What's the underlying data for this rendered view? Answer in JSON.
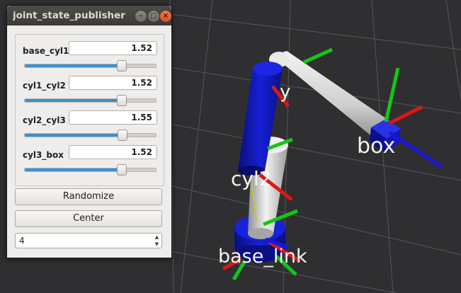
{
  "window": {
    "title": "joint_state_publisher",
    "minimize_glyph": "–",
    "maximize_glyph": "□",
    "close_glyph": "×"
  },
  "joints": [
    {
      "name": "base_cyl1",
      "value": "1.52",
      "slider_fraction": 0.735
    },
    {
      "name": "cyl1_cyl2",
      "value": "1.52",
      "slider_fraction": 0.735
    },
    {
      "name": "cyl2_cyl3",
      "value": "1.55",
      "slider_fraction": 0.74
    },
    {
      "name": "cyl3_box",
      "value": "1.52",
      "slider_fraction": 0.735
    }
  ],
  "buttons": {
    "randomize": "Randomize",
    "center": "Center"
  },
  "spinbox": {
    "value": "4",
    "up_glyph": "▲",
    "down_glyph": "▼"
  },
  "scene": {
    "labels": {
      "box": "box",
      "cyl2": "cyl2",
      "cyl1_partial": "y",
      "base_link": "base_link"
    },
    "colors": {
      "background": "#2f2f31",
      "grid": "#55555a",
      "link_gray": "#d6d6d6",
      "link_blue": "#0b14b8",
      "axis_x": "#e01515",
      "axis_y": "#16c516",
      "axis_z": "#1616e0"
    }
  }
}
